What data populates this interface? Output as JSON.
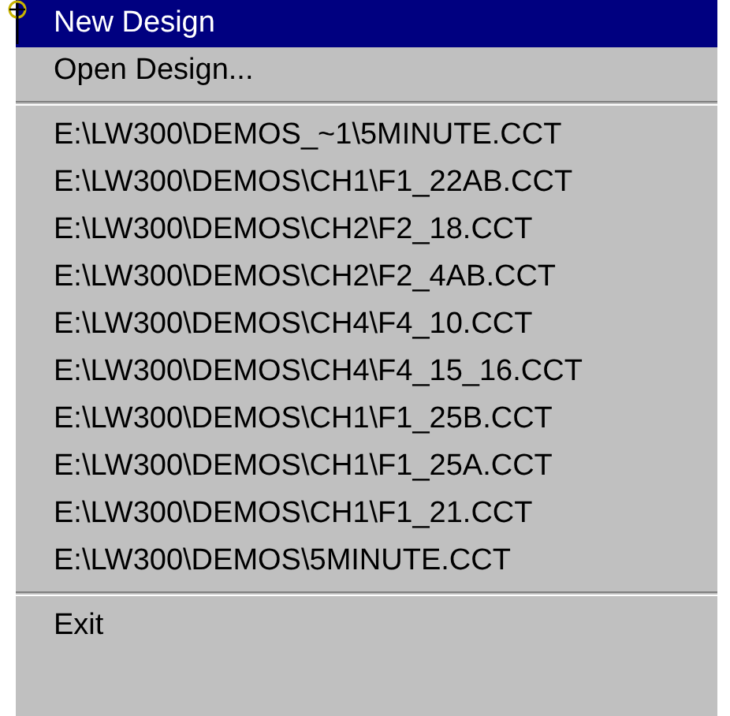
{
  "menu": {
    "items": [
      {
        "kind": "item",
        "label": "New Design",
        "selected": true
      },
      {
        "kind": "item",
        "label": "Open Design...",
        "selected": false
      },
      {
        "kind": "separator"
      },
      {
        "kind": "item",
        "label": "E:\\LW300\\DEMOS_~1\\5MINUTE.CCT",
        "selected": false
      },
      {
        "kind": "item",
        "label": "E:\\LW300\\DEMOS\\CH1\\F1_22AB.CCT",
        "selected": false
      },
      {
        "kind": "item",
        "label": "E:\\LW300\\DEMOS\\CH2\\F2_18.CCT",
        "selected": false
      },
      {
        "kind": "item",
        "label": "E:\\LW300\\DEMOS\\CH2\\F2_4AB.CCT",
        "selected": false
      },
      {
        "kind": "item",
        "label": "E:\\LW300\\DEMOS\\CH4\\F4_10.CCT",
        "selected": false
      },
      {
        "kind": "item",
        "label": "E:\\LW300\\DEMOS\\CH4\\F4_15_16.CCT",
        "selected": false
      },
      {
        "kind": "item",
        "label": "E:\\LW300\\DEMOS\\CH1\\F1_25B.CCT",
        "selected": false
      },
      {
        "kind": "item",
        "label": "E:\\LW300\\DEMOS\\CH1\\F1_25A.CCT",
        "selected": false
      },
      {
        "kind": "item",
        "label": "E:\\LW300\\DEMOS\\CH1\\F1_21.CCT",
        "selected": false
      },
      {
        "kind": "item",
        "label": "E:\\LW300\\DEMOS\\5MINUTE.CCT",
        "selected": false
      },
      {
        "kind": "separator"
      },
      {
        "kind": "item",
        "label": "Exit",
        "selected": false
      }
    ]
  }
}
